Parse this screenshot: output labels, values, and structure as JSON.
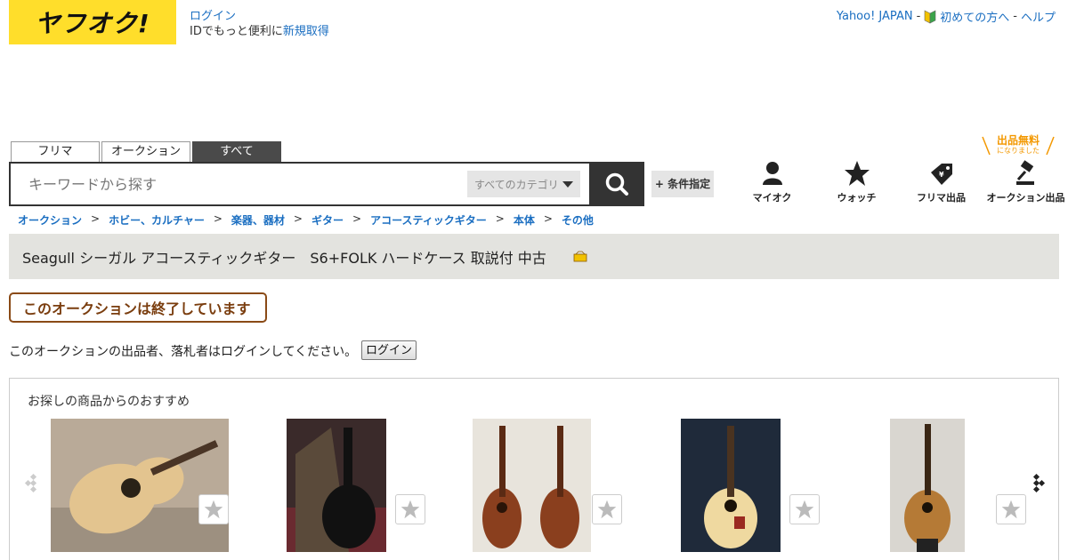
{
  "header": {
    "logo_text": "ヤフオク!",
    "login_link": "ログイン",
    "login_note_prefix": "IDでもっと便利に",
    "signup_link": "新規取得",
    "top_links": {
      "yahoo_japan": "Yahoo! JAPAN",
      "beginners": "初めての方へ",
      "help": "ヘルプ",
      "separator": "-"
    }
  },
  "search": {
    "tabs": [
      "フリマ",
      "オークション",
      "すべて"
    ],
    "active_tab": "すべて",
    "placeholder": "キーワードから探す",
    "category_select": "すべてのカテゴリ",
    "search_icon": "search-icon",
    "condition_button": "+ 条件指定"
  },
  "nav": {
    "free_badge": "出品無料",
    "free_badge_sub": "になりました",
    "items": [
      {
        "label": "マイオク",
        "icon": "user-icon"
      },
      {
        "label": "ウォッチ",
        "icon": "star-icon"
      },
      {
        "label": "フリマ出品",
        "icon": "price-tag-icon"
      },
      {
        "label": "オークション出品",
        "icon": "gavel-icon"
      }
    ]
  },
  "breadcrumb": [
    "オークション",
    "ホビー、カルチャー",
    "楽器、器材",
    "ギター",
    "アコースティックギター",
    "本体",
    "その他"
  ],
  "breadcrumb_sep": ">",
  "item": {
    "title": "Seagull シーガル アコースティックギター　S6+FOLK ハードケース 取説付 中古"
  },
  "status": {
    "ended": "このオークションは終了しています",
    "login_message": "このオークションの出品者、落札者はログインしてください。",
    "login_button": "ログイン"
  },
  "recommendations": {
    "title": "お探しの商品からのおすすめ"
  },
  "colors": {
    "brand_yellow": "#ffde2b",
    "link_blue": "#1a6ec1",
    "ended_brown": "#7a3d0e",
    "free_orange": "#f39800"
  }
}
